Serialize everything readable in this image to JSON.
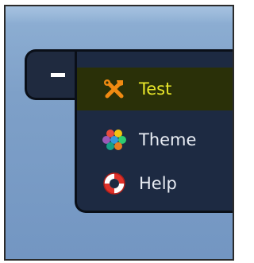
{
  "menu": {
    "toggle": {
      "glyph": "–",
      "icon": "minus-icon"
    },
    "items": [
      {
        "label": "Test",
        "icon": "tools-icon",
        "selected": true
      },
      {
        "label": "Theme",
        "icon": "palette-icon",
        "selected": false
      },
      {
        "label": "Help",
        "icon": "lifebuoy-icon",
        "selected": false
      }
    ]
  },
  "colors": {
    "panel_bg": "#1d2a42",
    "selected_bg": "#2a3008",
    "selected_text": "#e8e62a",
    "text": "#e9edf4",
    "backdrop": "#7ea0c8"
  }
}
